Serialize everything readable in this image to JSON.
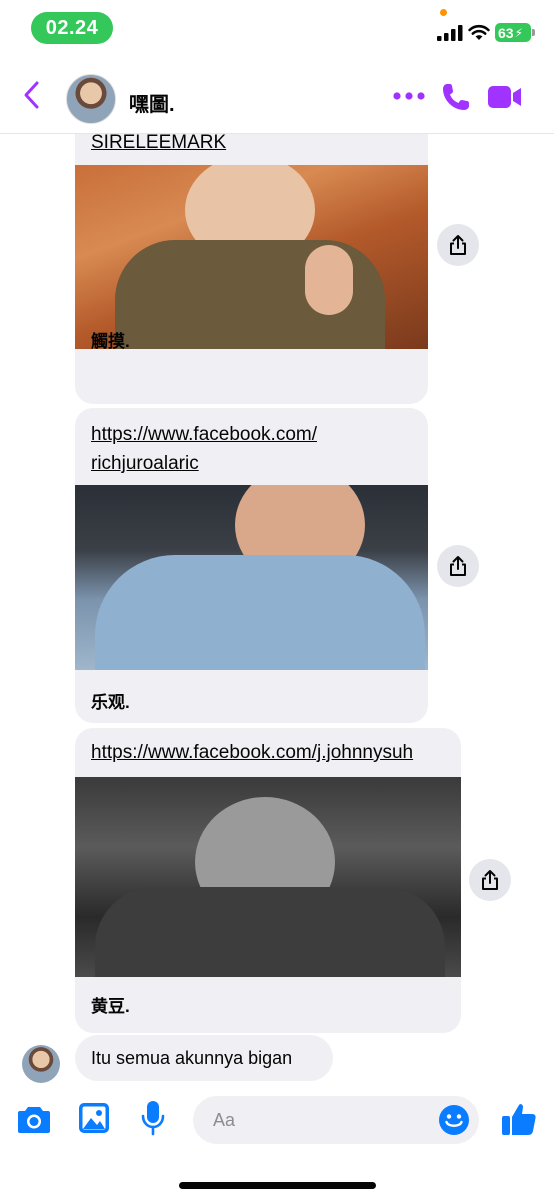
{
  "status_bar": {
    "time": "02.24",
    "battery": "63",
    "colors": {
      "time_pill": "#34c759",
      "battery": "#34c759",
      "privacy_dot": "#ff9500"
    },
    "icons": [
      "signal-icon",
      "wifi-icon",
      "battery-icon"
    ]
  },
  "header": {
    "contact_name": "嘿圖.",
    "accent_color": "#a033ff",
    "icons": [
      "back-icon",
      "more-dots-icon",
      "phone-call-icon",
      "video-call-icon"
    ]
  },
  "messages": [
    {
      "link": "SIRELEEMARK",
      "caption": "觸摸."
    },
    {
      "link_line1": "https://www.facebook.com/",
      "link_line2": "richjuroalaric",
      "caption": "乐观."
    },
    {
      "link": "https://www.facebook.com/j.johnnysuh",
      "caption": "黄豆."
    },
    {
      "text": "Itu semua akunnya bigan"
    }
  ],
  "composer": {
    "placeholder": "Aa",
    "accent_color": "#0a7cff",
    "icons": [
      "camera-icon",
      "gallery-icon",
      "microphone-icon",
      "emoji-icon",
      "thumbs-up-icon"
    ]
  }
}
